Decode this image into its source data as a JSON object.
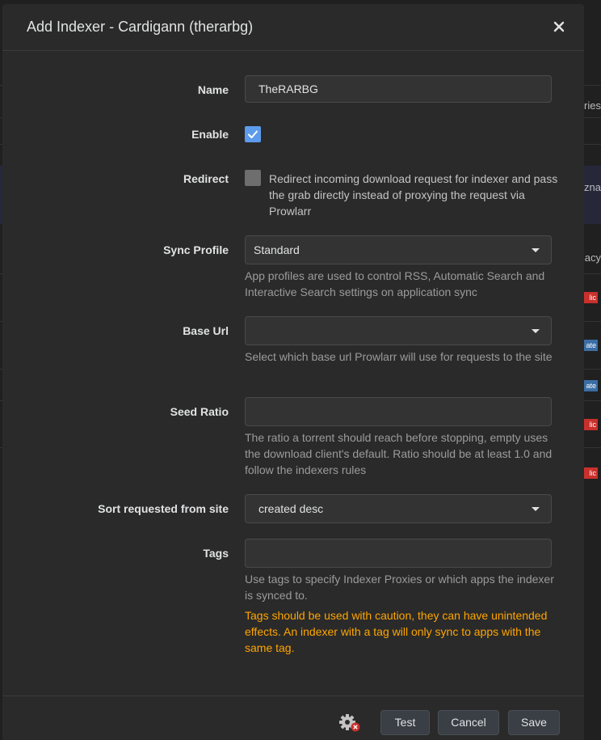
{
  "background": {
    "fragments": [
      "ries",
      "zna",
      "acy"
    ],
    "badges": [
      {
        "text": "lic",
        "color": "#c9302c"
      },
      {
        "text": "ate",
        "color": "#3a6ea5"
      },
      {
        "text": "ate",
        "color": "#3a6ea5"
      },
      {
        "text": "lic",
        "color": "#c9302c"
      },
      {
        "text": "lic",
        "color": "#c9302c"
      }
    ]
  },
  "modal": {
    "title": "Add Indexer - Cardigann (therarbg)",
    "close_icon": "close-icon"
  },
  "form": {
    "name": {
      "label": "Name",
      "value": "TheRARBG"
    },
    "enable": {
      "label": "Enable",
      "checked": true
    },
    "redirect": {
      "label": "Redirect",
      "checked": false,
      "help": "Redirect incoming download request for indexer and pass the grab directly instead of proxying the request via Prowlarr"
    },
    "sync_profile": {
      "label": "Sync Profile",
      "value": "Standard",
      "help": "App profiles are used to control RSS, Automatic Search and Interactive Search settings on application sync"
    },
    "base_url": {
      "label": "Base Url",
      "value": "",
      "help": "Select which base url Prowlarr will use for requests to the site"
    },
    "seed_ratio": {
      "label": "Seed Ratio",
      "value": "",
      "help": "The ratio a torrent should reach before stopping, empty uses the download client's default. Ratio should be at least 1.0 and follow the indexers rules"
    },
    "sort": {
      "label": "Sort requested from site",
      "value": "created desc"
    },
    "tags": {
      "label": "Tags",
      "value": "",
      "help": "Use tags to specify Indexer Proxies or which apps the indexer is synced to.",
      "warning": "Tags should be used with caution, they can have unintended effects. An indexer with a tag will only sync to apps with the same tag."
    }
  },
  "footer": {
    "test_label": "Test",
    "cancel_label": "Cancel",
    "save_label": "Save",
    "status_icon": "gear-error-icon"
  },
  "colors": {
    "accent": "#5d9cec",
    "warning": "#ffa500",
    "error": "#c9302c"
  }
}
